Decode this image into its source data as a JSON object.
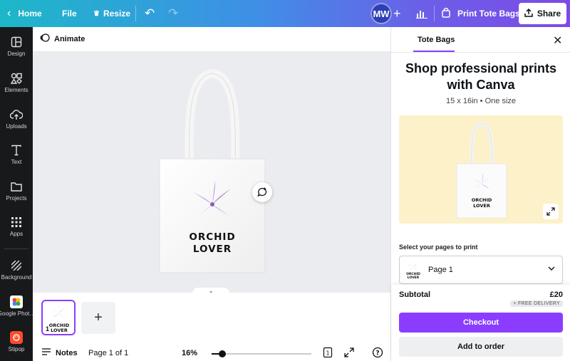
{
  "topbar": {
    "home_label": "Home",
    "file_label": "File",
    "resize_label": "Resize",
    "avatar_initials": "MW",
    "print_label": "Print Tote Bags",
    "share_label": "Share"
  },
  "rail": {
    "items": [
      {
        "label": "Design",
        "icon": "layout-icon"
      },
      {
        "label": "Elements",
        "icon": "shapes-icon"
      },
      {
        "label": "Uploads",
        "icon": "cloud-upload-icon"
      },
      {
        "label": "Text",
        "icon": "text-icon"
      },
      {
        "label": "Projects",
        "icon": "folder-icon"
      },
      {
        "label": "Apps",
        "icon": "apps-grid-icon"
      },
      {
        "label": "Background",
        "icon": "stripes-icon"
      },
      {
        "label": "Google Phot…",
        "icon": "google-photos-icon"
      },
      {
        "label": "Stipop",
        "icon": "stipop-icon"
      }
    ]
  },
  "editor": {
    "animate_label": "Animate",
    "design_text_line1": "ORCHID",
    "design_text_line2": "LOVER",
    "thumb_page_number": "1",
    "notes_label": "Notes",
    "page_count": "Page 1 of 1",
    "zoom_level": "16%",
    "zoom_fraction": 0.11,
    "pages_badge": "1"
  },
  "panel": {
    "tab_label": "Tote Bags",
    "title": "Shop professional prints with Canva",
    "subtitle": "15 x 16in • One size",
    "select_label": "Select your pages to print",
    "selected_page": "Page 1",
    "subtotal_label": "Subtotal",
    "subtotal_value": "£20",
    "delivery_badge": "+ FREE DELIVERY",
    "checkout_label": "Checkout",
    "add_to_order_label": "Add to order"
  },
  "colors": {
    "accent": "#8b3dff",
    "rail_bg": "#18191b",
    "stage_bg": "#ebecf0",
    "preview_bg": "#fcf1c9"
  }
}
